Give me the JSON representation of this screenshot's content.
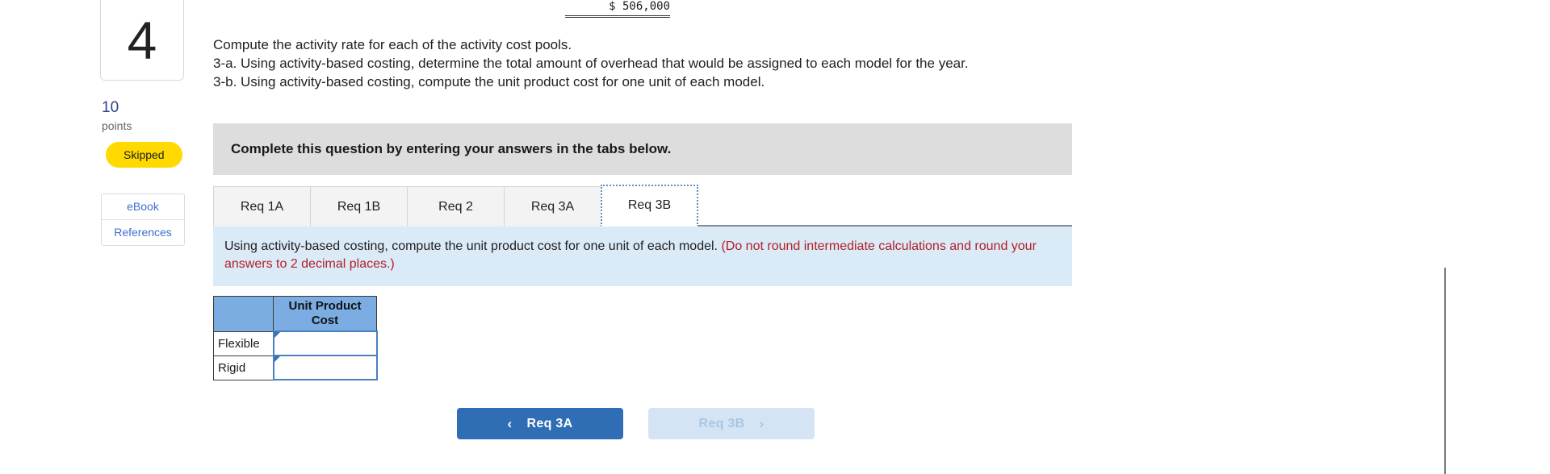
{
  "sidebar": {
    "question_number": "4",
    "points_value": "10",
    "points_label": "points",
    "status_badge": "Skipped",
    "resource_links": [
      {
        "label": "eBook"
      },
      {
        "label": "References"
      }
    ]
  },
  "residual": {
    "amount": "$ 506,000"
  },
  "prompt": {
    "lines": [
      "Compute the activity rate for each of the activity cost pools.",
      "3-a. Using activity-based costing, determine the total amount of overhead that would be assigned to each model for the year.",
      "3-b. Using activity-based costing, compute the unit product cost for one unit of each model."
    ]
  },
  "panel": {
    "heading": "Complete this question by entering your answers in the tabs below.",
    "tabs": [
      {
        "label": "Req 1A",
        "active": false
      },
      {
        "label": "Req 1B",
        "active": false
      },
      {
        "label": "Req 2",
        "active": false
      },
      {
        "label": "Req 3A",
        "active": false
      },
      {
        "label": "Req 3B",
        "active": true
      }
    ],
    "instruction": {
      "black_text": "Using activity-based costing, compute the unit product cost for one unit of each model. ",
      "red_text": "(Do not round intermediate calculations and round your answers to 2 decimal places.)"
    },
    "table": {
      "headers": [
        "",
        "Unit Product Cost"
      ],
      "rows": [
        {
          "label": "Flexible",
          "value": "",
          "placeholder": ""
        },
        {
          "label": "Rigid",
          "value": "",
          "placeholder": ""
        }
      ]
    },
    "nav": {
      "prev_label": "Req 3A",
      "prev_icon": "chevron-left",
      "next_label": "Req 3B",
      "next_icon": "chevron-right"
    }
  },
  "colors": {
    "accent_blue": "#2f6eb5",
    "table_header_blue": "#7badE2",
    "instruction_blue": "#daeaf7",
    "panel_gray": "#dddddd",
    "badge_yellow": "#ffd900",
    "red_note": "#b32025"
  }
}
